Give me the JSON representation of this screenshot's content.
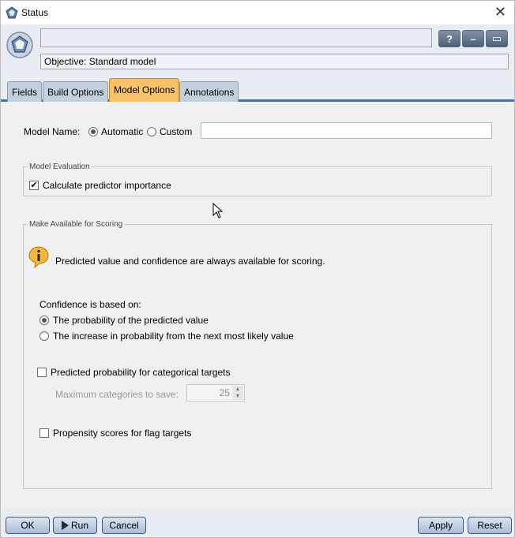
{
  "window": {
    "title": "Status"
  },
  "header": {
    "objective_label": "Objective: Standard model"
  },
  "tabs": [
    {
      "label": "Fields"
    },
    {
      "label": "Build Options"
    },
    {
      "label": "Model Options"
    },
    {
      "label": "Annotations"
    }
  ],
  "model_name": {
    "label": "Model Name:",
    "option_automatic": "Automatic",
    "option_custom": "Custom",
    "selected": "Automatic",
    "custom_value": ""
  },
  "model_evaluation": {
    "title": "Model Evaluation",
    "calculate_predictor_importance": "Calculate predictor importance",
    "calculate_checked": true
  },
  "scoring": {
    "title": "Make Available for Scoring",
    "info_text": "Predicted value and confidence are always available for scoring.",
    "confidence_label": "Confidence is based on:",
    "option_probability": "The probability of the predicted value",
    "option_increase": "The increase in probability from the next most likely value",
    "selected_confidence": "probability",
    "predicted_probability_label": "Predicted probability for categorical targets",
    "predicted_probability_checked": false,
    "max_categories_label": "Maximum categories to save:",
    "max_categories_value": "25",
    "propensity_label": "Propensity scores for flag targets",
    "propensity_checked": false
  },
  "footer": {
    "ok": "OK",
    "run": "Run",
    "cancel": "Cancel",
    "apply": "Apply",
    "reset": "Reset"
  },
  "colors": {
    "header_bg": "#e8edf3",
    "active_tab": "#f7c26a",
    "tab_underline": "#4a6fa5",
    "panel_bg": "#f0f0f0"
  }
}
